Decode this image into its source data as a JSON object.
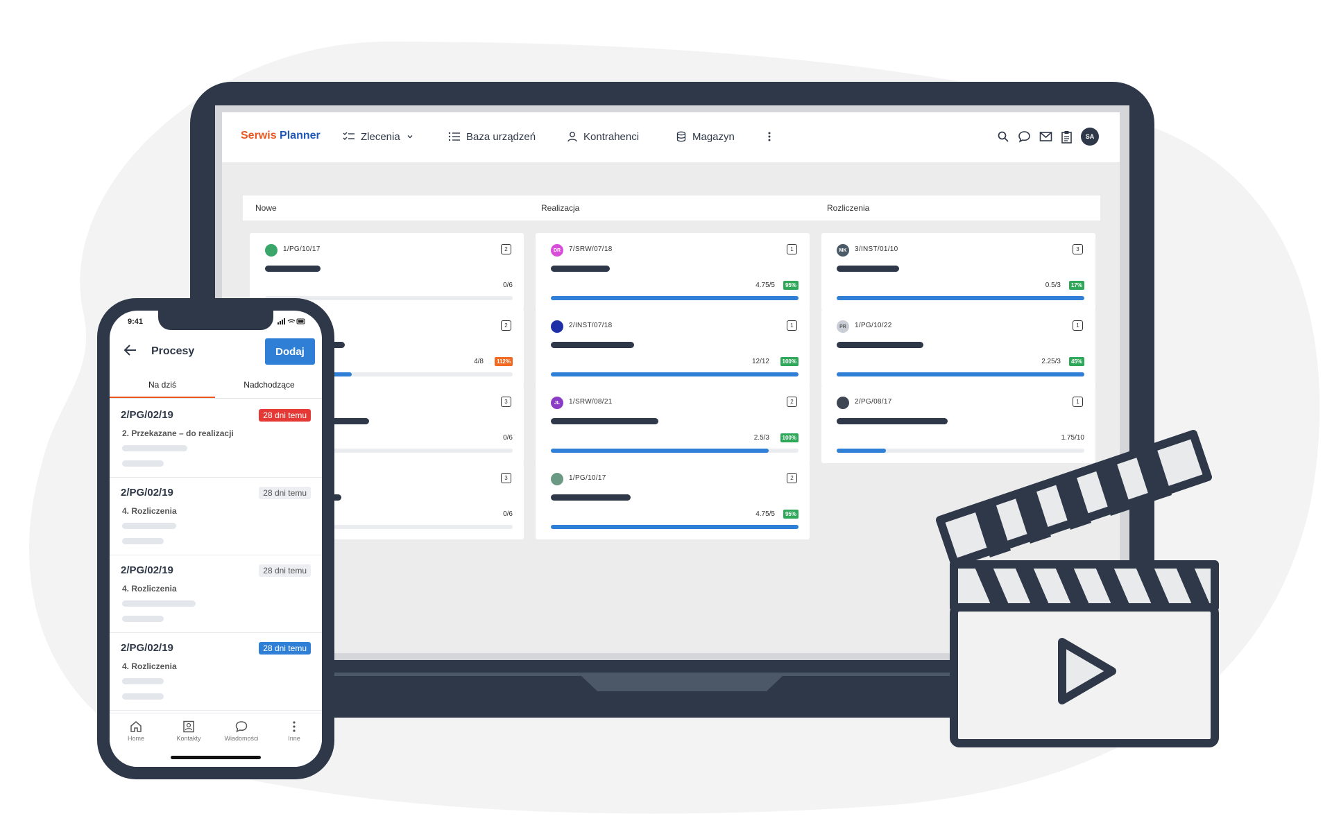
{
  "colors": {
    "accent": "#2f7fd6",
    "brand_orange": "#e8571e",
    "brand_blue": "#1e57b8",
    "frame": "#2e3848",
    "ok_green": "#2fa85a",
    "warn_orange": "#f26a21",
    "danger_red": "#e53935"
  },
  "app": {
    "logo_part1": "Serwis",
    "logo_part2": "Planner",
    "nav": [
      {
        "label": "Zlecenia",
        "icon": "checklist-icon"
      },
      {
        "label": "Baza urządzeń",
        "icon": "list-icon"
      },
      {
        "label": "Kontrahenci",
        "icon": "person-icon"
      },
      {
        "label": "Magazyn",
        "icon": "database-icon"
      }
    ],
    "user_initials": "SA"
  },
  "board": {
    "columns": [
      {
        "title": "Nowe",
        "cards": [
          {
            "code": "1/PG/10/17",
            "count": "2",
            "ratio": "0/6",
            "pct": "",
            "progress": 0,
            "avatar": "",
            "avatar_color": "#3aa66a"
          },
          {
            "code": "",
            "count": "2",
            "ratio": "4/8",
            "pct": "112%",
            "progress": 0.35,
            "avatar": "",
            "avatar_color": ""
          },
          {
            "code": "",
            "count": "3",
            "ratio": "0/6",
            "pct": "",
            "progress": 0,
            "avatar": "",
            "avatar_color": ""
          },
          {
            "code": "",
            "count": "3",
            "ratio": "0/6",
            "pct": "",
            "progress": 0,
            "avatar": "",
            "avatar_color": ""
          }
        ]
      },
      {
        "title": "Realizacja",
        "cards": [
          {
            "code": "7/SRW/07/18",
            "count": "1",
            "ratio": "4.75/5",
            "pct": "95%",
            "progress": 1,
            "avatar": "DR",
            "avatar_color": "#d94ed8"
          },
          {
            "code": "2/INST/07/18",
            "count": "1",
            "ratio": "12/12",
            "pct": "100%",
            "progress": 1,
            "avatar": "",
            "avatar_color": "#1f2fa8"
          },
          {
            "code": "1/SRW/08/21",
            "count": "2",
            "ratio": "2.5/3",
            "pct": "100%",
            "progress": 0.88,
            "avatar": "JL",
            "avatar_color": "#8a3dc4"
          },
          {
            "code": "1/PG/10/17",
            "count": "2",
            "ratio": "4.75/5",
            "pct": "95%",
            "progress": 1,
            "avatar": "",
            "avatar_color": "#6b9a84"
          }
        ]
      },
      {
        "title": "Rozliczenia",
        "cards": [
          {
            "code": "3/INST/01/10",
            "count": "3",
            "ratio": "0.5/3",
            "pct": "17%",
            "progress": 1,
            "avatar": "MK",
            "avatar_color": "#4a5a66"
          },
          {
            "code": "1/PG/10/22",
            "count": "1",
            "ratio": "2.25/3",
            "pct": "45%",
            "progress": 1,
            "avatar": "PR",
            "avatar_color": "#c9ced6"
          },
          {
            "code": "2/PG/08/17",
            "count": "1",
            "ratio": "1.75/10",
            "pct": "",
            "progress": 0.2,
            "avatar": "",
            "avatar_color": "#3d4652"
          }
        ]
      }
    ]
  },
  "phone": {
    "time": "9:41",
    "title": "Procesy",
    "add_label": "Dodaj",
    "tabs": [
      "Na dziś",
      "Nadchodzące"
    ],
    "items": [
      {
        "code": "2/PG/02/19",
        "badge": "28 dni temu",
        "badge_style": "red",
        "sub": "2. Przekazane – do realizacji"
      },
      {
        "code": "2/PG/02/19",
        "badge": "28 dni temu",
        "badge_style": "gray",
        "sub": "4. Rozliczenia"
      },
      {
        "code": "2/PG/02/19",
        "badge": "28 dni temu",
        "badge_style": "gray",
        "sub": "4. Rozliczenia"
      },
      {
        "code": "2/PG/02/19",
        "badge": "28 dni temu",
        "badge_style": "blue",
        "sub": "4. Rozliczenia"
      }
    ],
    "bottom_nav": [
      "Home",
      "Kontakty",
      "Wiadomości",
      "Inne"
    ]
  }
}
